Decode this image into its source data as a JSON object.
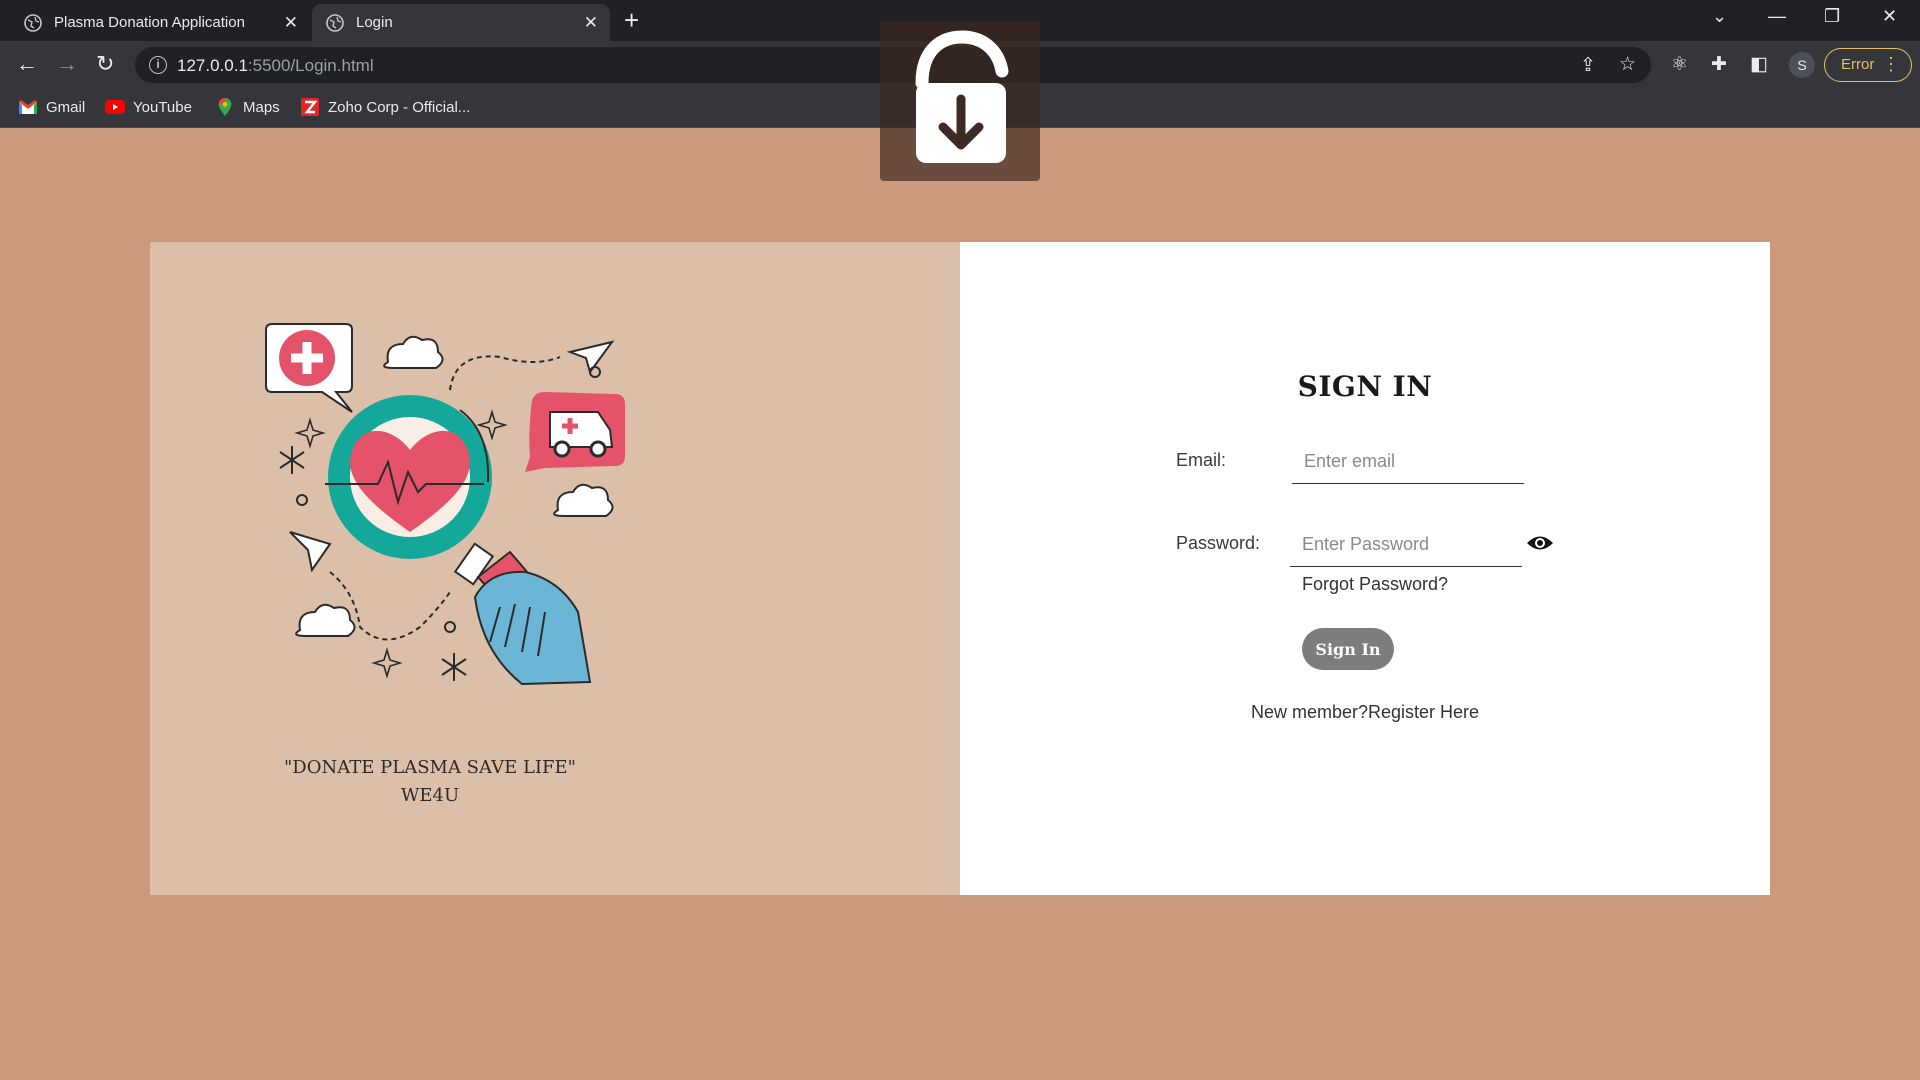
{
  "browser": {
    "tabs": [
      {
        "title": "Plasma Donation Application",
        "active": false
      },
      {
        "title": "Login",
        "active": true
      }
    ],
    "url_host": "127.0.0.1",
    "url_path": ":5500/Login.html",
    "profile_initial": "S",
    "error_label": "Error",
    "bookmarks": [
      {
        "label": "Gmail",
        "icon": "gmail-icon"
      },
      {
        "label": "YouTube",
        "icon": "youtube-icon"
      },
      {
        "label": "Maps",
        "icon": "maps-icon"
      },
      {
        "label": "Zoho Corp - Official...",
        "icon": "zoho-icon"
      }
    ]
  },
  "hero": {
    "quote_line1": "\"DONATE PLASMA SAVE LIFE\"",
    "quote_line2": "WE4U"
  },
  "login": {
    "title": "SIGN IN",
    "email_label": "Email:",
    "email_placeholder": "Enter email",
    "email_value": "",
    "password_label": "Password:",
    "password_placeholder": "Enter Password",
    "password_value": "",
    "forgot_label": "Forgot Password?",
    "submit_label": "Sign In",
    "register_text": "New member?Register Here"
  },
  "colors": {
    "page_bg": "#cb9a7d",
    "left_panel_bg": "#dcbfa9",
    "button_bg": "#7d7d7d",
    "accent_red": "#e5536a",
    "accent_teal": "#13a89a",
    "accent_blue": "#6bb6d6"
  }
}
